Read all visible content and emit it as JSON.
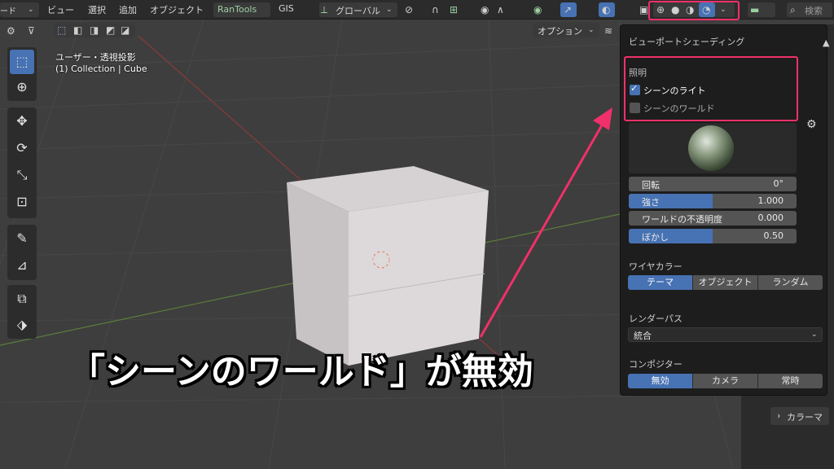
{
  "header": {
    "mode_label": "モード",
    "menus": [
      "ビュー",
      "選択",
      "追加",
      "オブジェクト"
    ],
    "addon_menus": [
      "RanTools",
      "GIS"
    ],
    "transform_orientation": "グローバル",
    "search_placeholder": "検索"
  },
  "subheader": {
    "options_label": "オプション"
  },
  "viewport": {
    "view_name": "ユーザー・透視投影",
    "collection_info": "(1) Collection | Cube"
  },
  "shading_popover": {
    "title": "ビューポートシェーディング",
    "lighting_title": "照明",
    "scene_lights_label": "シーンのライト",
    "scene_lights_checked": true,
    "scene_world_label": "シーンのワールド",
    "scene_world_checked": false,
    "rotation": {
      "label": "回転",
      "value": "0°"
    },
    "strength": {
      "label": "強さ",
      "value": "1.000",
      "fill": 0.5
    },
    "world_opacity": {
      "label": "ワールドの不透明度",
      "value": "0.000",
      "fill": 0
    },
    "blur": {
      "label": "ぼかし",
      "value": "0.50",
      "fill": 0.5
    },
    "wire_color_title": "ワイヤカラー",
    "wire_color_options": [
      "テーマ",
      "オブジェクト",
      "ランダム"
    ],
    "wire_color_active": "テーマ",
    "render_pass_title": "レンダーパス",
    "render_pass_value": "統合",
    "compositor_title": "コンポジター",
    "compositor_options": [
      "無効",
      "カメラ",
      "常時"
    ],
    "compositor_active": "無効"
  },
  "right_panel": {
    "color_label": "カラーマ"
  },
  "caption": "「シーンのワールド」が無効",
  "colors": {
    "accent": "#4772b3",
    "highlight": "#f0306a",
    "background": "#3e3e3e"
  }
}
